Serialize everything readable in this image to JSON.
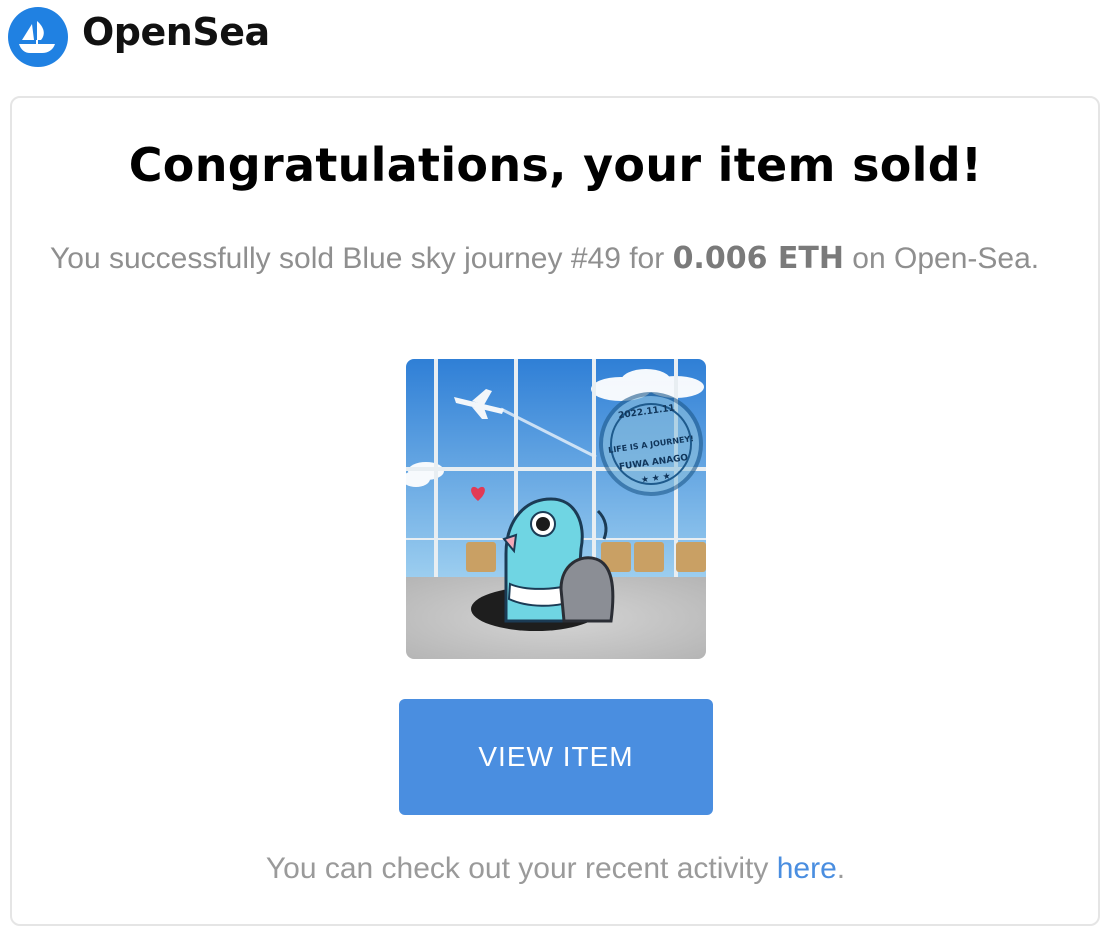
{
  "header": {
    "brand": "OpenSea",
    "logo_icon": "opensea-sailboat-icon",
    "logo_color": "#2081E2"
  },
  "email": {
    "title": "Congratulations, your item sold!",
    "message_prefix": "You successfully sold Blue sky journey #49 for ",
    "price": "0.006 ETH",
    "message_suffix": " on Open-Sea.",
    "view_button": "VIEW ITEM",
    "footer_prefix": "You can check out your recent activity ",
    "footer_link": "here",
    "footer_suffix": "."
  },
  "nft_image": {
    "stamp_date": "2022.11.11",
    "stamp_line1": "LIFE IS A JOURNEY!",
    "stamp_line2": "FUWA ANAGO"
  },
  "colors": {
    "button": "#4a8ee0",
    "link": "#4a8ee0",
    "muted_text": "#8f8f8f"
  }
}
